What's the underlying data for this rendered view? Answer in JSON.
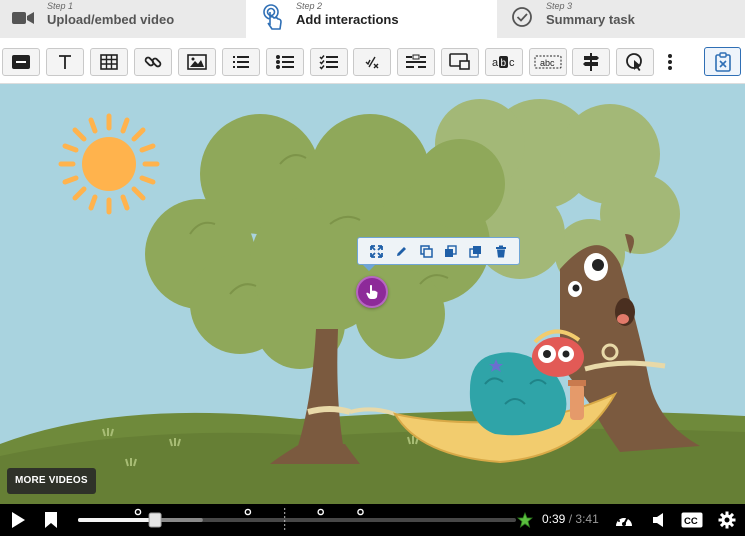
{
  "steps": [
    {
      "step_label": "Step 1",
      "title": "Upload/embed video",
      "icon": "video-camera-icon"
    },
    {
      "step_label": "Step 2",
      "title": "Add interactions",
      "icon": "touch-icon"
    },
    {
      "step_label": "Step 3",
      "title": "Summary task",
      "icon": "check-circle-icon"
    }
  ],
  "toolbar": {
    "tools": [
      "label-tool",
      "text-tool",
      "table-tool",
      "link-tool",
      "image-tool",
      "statements-tool",
      "single-choice-tool",
      "multiple-choice-tool",
      "true-false-tool",
      "fill-in-blanks-tool",
      "drag-question-tool",
      "mark-words-tool",
      "drag-text-tool",
      "crossroads-tool",
      "navigation-hotspot-tool"
    ],
    "more_icon": "vertical-dots-icon",
    "close_icon": "clipboard-close-icon"
  },
  "video": {
    "more_videos_label": "MORE VIDEOS",
    "interaction_toolbar_icons": [
      "fullscreen-icon",
      "edit-icon",
      "copy-icon",
      "bring-front-icon",
      "send-back-icon",
      "delete-icon"
    ],
    "hotspot_icon": "hand-pointer-icon"
  },
  "player": {
    "current_time": "0:39",
    "separator": "/",
    "duration": "3:41",
    "progress_fraction": 0.176,
    "buffered_fraction": 0.285,
    "interaction_markers_fraction": [
      0.137,
      0.388,
      0.554,
      0.645
    ],
    "bookmark_marker_fraction": 0.472,
    "accent": "#5bbf3f"
  },
  "colors": {
    "sky": "#a9d3df",
    "foliage": "#8fa85a",
    "trunk": "#7b5a3f",
    "grass": "#6f8a3b",
    "hotspot": "#8d2a99",
    "accent_blue": "#2f6fb5"
  }
}
